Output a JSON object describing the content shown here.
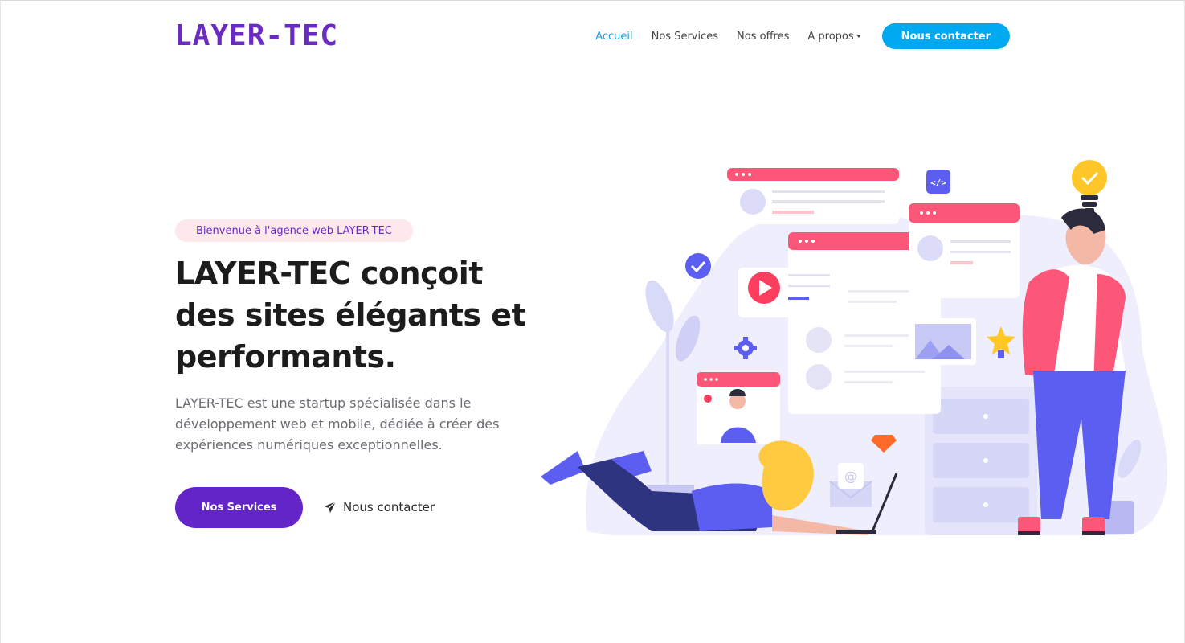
{
  "header": {
    "logo": "LAYER-TEC",
    "nav": [
      {
        "label": "Accueil",
        "active": true
      },
      {
        "label": "Nos Services",
        "active": false
      },
      {
        "label": "Nos offres",
        "active": false
      },
      {
        "label": "A propos",
        "active": false,
        "dropdown": true
      }
    ],
    "cta_label": "Nous contacter"
  },
  "hero": {
    "badge": "Bienvenue à l'agence web LAYER-TEC",
    "title": "LAYER-TEC conçoit des sites élégants et performants.",
    "description": "LAYER-TEC est une startup spécialisée dans le développement web et mobile, dédiée à créer des expériences numériques exceptionnelles.",
    "primary_button": "Nos Services",
    "secondary_button": "Nous contacter",
    "secondary_icon": "paper-plane-icon"
  },
  "colors": {
    "brand_purple": "#6a2bc2",
    "primary_button": "#6425c8",
    "accent_blue": "#00a8f0",
    "active_link": "#1ea0e0",
    "badge_bg": "#fde8ec",
    "illustration_pink": "#fc5679",
    "illustration_violet": "#5b5ef0"
  }
}
